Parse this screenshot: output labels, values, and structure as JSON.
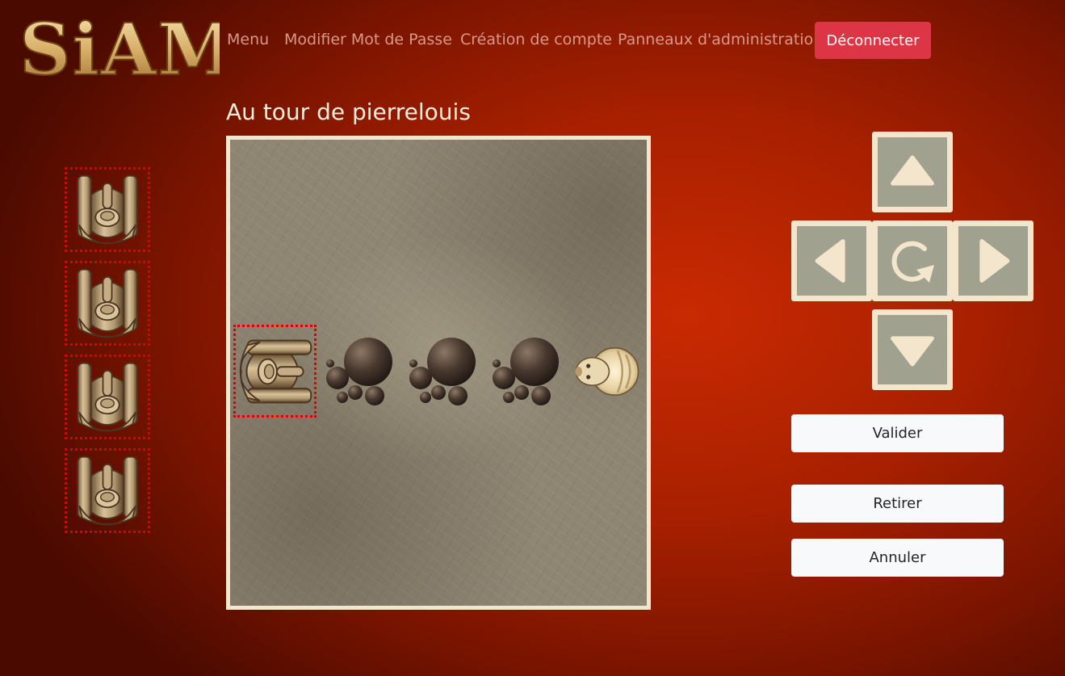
{
  "header": {
    "logo_text": "SiAM",
    "nav": [
      "Menu",
      "Modifier Mot de Passe",
      "Création de compte",
      "Panneaux d'administration"
    ],
    "logout_label": "Déconnecter"
  },
  "game": {
    "turn_text": "Au tour de pierrelouis",
    "board": {
      "pieces": [
        {
          "type": "elephant-icon",
          "facing": "right",
          "selected": true
        },
        {
          "type": "rock-icon"
        },
        {
          "type": "rock-icon"
        },
        {
          "type": "rock-icon"
        },
        {
          "type": "lion-icon",
          "facing": "left"
        }
      ]
    },
    "reserve_count": 4,
    "reserve_piece": "elephant-icon"
  },
  "controls": {
    "up": "arrow-up-icon",
    "left": "arrow-left-icon",
    "rotate": "rotate-icon",
    "right": "arrow-right-icon",
    "down": "arrow-down-icon",
    "validate_label": "Valider",
    "withdraw_label": "Retirer",
    "cancel_label": "Annuler"
  },
  "colors": {
    "background": "#b82200",
    "logout": "#dc3545",
    "board_frame": "#f3e6cc",
    "selection": "#e00000",
    "control_fill": "#a0a18f"
  }
}
